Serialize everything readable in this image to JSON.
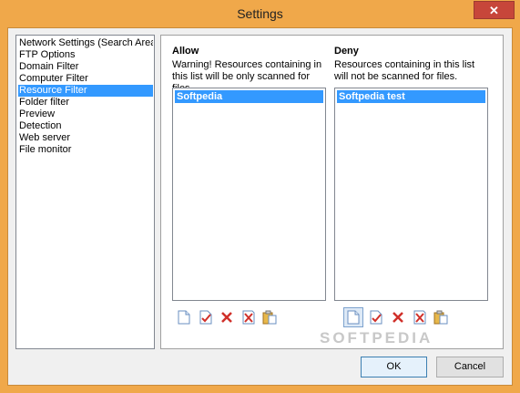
{
  "window": {
    "title": "Settings",
    "close_glyph": "✕"
  },
  "nav": {
    "items": [
      {
        "label": "Network Settings (Search Area"
      },
      {
        "label": "FTP Options"
      },
      {
        "label": "Domain Filter"
      },
      {
        "label": "Computer Filter"
      },
      {
        "label": "Resource Filter",
        "selected": true
      },
      {
        "label": "Folder filter"
      },
      {
        "label": "Preview"
      },
      {
        "label": "Detection"
      },
      {
        "label": "Web server"
      },
      {
        "label": "File monitor"
      }
    ]
  },
  "allow": {
    "title": "Allow",
    "desc_line1": "Warning! Resources containing in",
    "desc_line2": "this list will be only scanned for files.",
    "items": [
      "Softpedia"
    ]
  },
  "deny": {
    "title": "Deny",
    "desc_line1": "Resources containing in this list",
    "desc_line2": "will not be scanned for files.",
    "items": [
      "Softpedia test"
    ]
  },
  "toolbar_icons": [
    "new-document-icon",
    "edit-check-icon",
    "delete-x-icon",
    "clear-all-icon",
    "paste-icon"
  ],
  "watermark": "SOFTPEDIA",
  "buttons": {
    "ok": "OK",
    "cancel": "Cancel"
  },
  "colors": {
    "titlebar": "#f0a84a",
    "selection": "#3399ff",
    "close": "#c7463a"
  }
}
